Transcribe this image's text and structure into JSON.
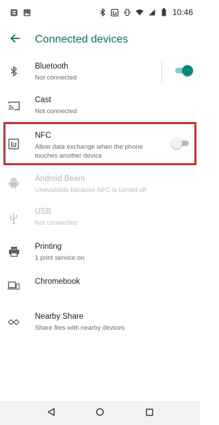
{
  "status_bar": {
    "time": "10:46",
    "left_icons": [
      "notification-icon",
      "image-icon"
    ],
    "right_icons": [
      "bluetooth-icon",
      "nfc-icon",
      "vibrate-icon",
      "wifi-icon",
      "signal-icon",
      "battery-icon"
    ]
  },
  "app_bar": {
    "title": "Connected devices",
    "back_icon": "arrow-back-icon"
  },
  "items": [
    {
      "label": "Bluetooth",
      "summary": "Not connected",
      "icon": "bluetooth-icon",
      "toggle": "on",
      "enabled": true
    },
    {
      "label": "Cast",
      "summary": "Not connected",
      "icon": "cast-icon",
      "enabled": true
    },
    {
      "label": "NFC",
      "summary": "Allow data exchange when the phone touches another device",
      "icon": "nfc-icon",
      "toggle": "off",
      "enabled": true
    },
    {
      "label": "Android Beam",
      "summary": "Unavailable because NFC is turned off",
      "icon": "android-icon",
      "enabled": false
    },
    {
      "label": "USB",
      "summary": "Not connected",
      "icon": "usb-icon",
      "enabled": false
    },
    {
      "label": "Printing",
      "summary": "1 print service on",
      "icon": "printer-icon",
      "enabled": true
    },
    {
      "label": "Chromebook",
      "summary": "",
      "icon": "laptop-phone-icon",
      "enabled": true
    },
    {
      "label": "Nearby Share",
      "summary": "Share files with nearby devices",
      "icon": "nearby-share-icon",
      "enabled": true
    }
  ],
  "nav_bar": {
    "back": "nav-back-icon",
    "home": "nav-home-icon",
    "recents": "nav-recents-icon"
  },
  "colors": {
    "accent": "#00796b",
    "toggle_on": "#00897b",
    "highlight_border": "#d32f2f",
    "icon": "#5f6368",
    "disabled": "#bdbdbd"
  }
}
